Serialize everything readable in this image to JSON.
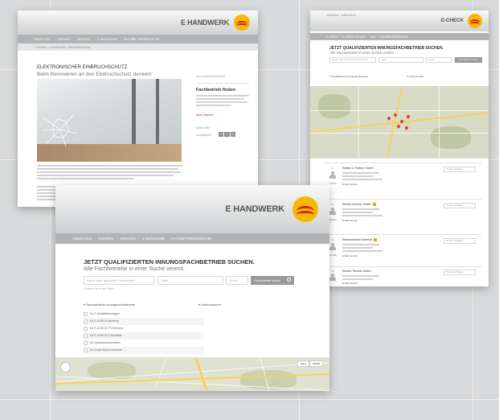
{
  "brand": {
    "name": "E HANDWERK",
    "name_echeck": "E-CHECK",
    "colors": {
      "logo_yellow": "#f6b800",
      "logo_red": "#d5231b",
      "nav_gray": "#b2b3b4",
      "background": "#d9dadb"
    }
  },
  "icons": [
    "e-handwerk-logo-icon",
    "person-icon",
    "pan-control-icon",
    "search-icon",
    "checkbox-icon",
    "chevron-down-icon"
  ],
  "article_page": {
    "nav": [
      "ÜBER UNS",
      "THEMEN",
      "SERVICE",
      "E-MAGAZINE",
      "FACHBETRIEBSSUCHE"
    ],
    "breadcrumb": "Themen > Sicherheit > Einbruchschutz",
    "title": "ELEKTRONISCHER EINBRUCHSCHUTZ",
    "subtitle": "Beim Renovieren an den Einbruchschutz denken!",
    "sidebar": {
      "link": "Zum Elektrofachbetrieb",
      "heading": "Fachbetrieb finden",
      "more": "Mehr erfahren",
      "share": "Seite teilen",
      "font_size_label": "Schriftgröße",
      "font_sizes": [
        "A",
        "A",
        "A"
      ]
    }
  },
  "echeck_page": {
    "header_links": "Impressum · Datenschutz",
    "nav": [
      "E-CHECK",
      "E-CHECK IST WAS",
      "FAQ",
      "FACHBETRIEBSSUCHE"
    ],
    "title": "JETZT QUALIFIZIERTEN INNUNGSFACHBETRIEB SUCHEN.",
    "subtitle": "Alle Fachbetriebe in einer Suche vereint.",
    "search_placeholder": "Name oder gesuchte Fachbetrieb",
    "location_value": "Stadt",
    "radius_value": "10 km",
    "search_button": "Fachbetrieb finden",
    "filter_left": "Spezialisierte Innungsfachbetriebe",
    "filter_right": "Umkreissuche",
    "results": [
      {
        "number": "1",
        "distance": "1,8 km",
        "name": "Elektro & Partner GmbH",
        "more": "E-Mail senden",
        "select": "Termin anfragen",
        "badge": false
      },
      {
        "number": "2",
        "distance": "2,4 km",
        "name": "Elektro Service GmbH",
        "more": "E-Mail senden",
        "select": "Termin anfragen",
        "badge": true
      },
      {
        "number": "3",
        "distance": "3,1 km",
        "name": "Elektromeister Schmidt",
        "more": "E-Mail senden",
        "select": "Termin anfragen",
        "badge": true
      },
      {
        "number": "4",
        "distance": "4,2 km",
        "name": "Elektro-Technik GmbH",
        "more": "E-Mail senden",
        "select": "Termin anfragen",
        "badge": false
      }
    ]
  },
  "search_page": {
    "nav": [
      "ÜBER UNS",
      "THEMEN",
      "SERVICE",
      "E-MAGAZINE",
      "FACHBETRIEBSSUCHE"
    ],
    "title": "JETZT QUALIFIZIERTEN INNUNGSFACHBETRIEB SUCHEN.",
    "subtitle": "Alle Fachbetriebe in einer Suche vereint.",
    "search_placeholder": "Name oder gesuchte Fachbetrieb",
    "location_value": "Stadt",
    "radius_value": "10 km",
    "search_button": "Fachbetrieb finden",
    "helper_text": "Suchen Sie in der Nähe",
    "filter_left": "Spezialisierte Innungsfachbetriebe",
    "filter_right": "Umkreissuche",
    "options": [
      "für E-Mobilitätsanlagen",
      "für E-CHECK Betriebe",
      "für E-CHECK PV Betriebe",
      "für E-CHECK E-Mobilität",
      "für Gebäudeautomation",
      "für Smart Home Betriebe",
      "für Sicherheitstechnik Betriebe"
    ],
    "map_types": [
      "Karte",
      "Satellit"
    ]
  }
}
